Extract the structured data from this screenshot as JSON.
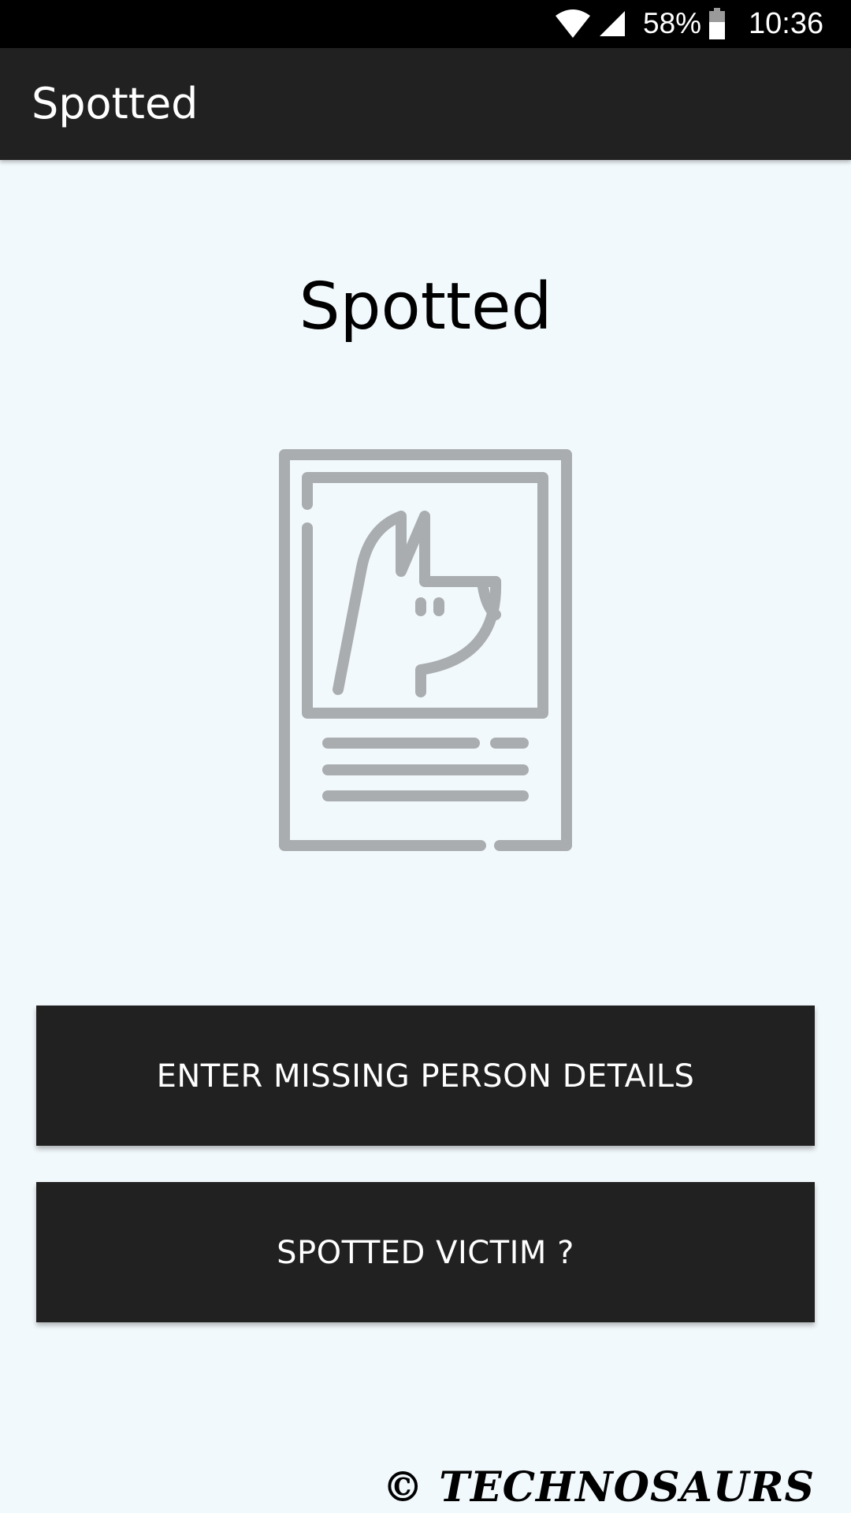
{
  "status_bar": {
    "battery_percent": "58%",
    "time": "10:36",
    "icons": [
      "wifi-icon",
      "cell-signal-icon",
      "battery-icon"
    ]
  },
  "app_bar": {
    "title": "Spotted"
  },
  "main": {
    "headline": "Spotted",
    "illustration": "missing-pet-poster-icon",
    "buttons": {
      "missing_person": "ENTER MISSING PERSON DETAILS",
      "spotted_victim": "SPOTTED VICTIM ?"
    }
  },
  "footer": {
    "copyright": "© TECHNOSAURS"
  },
  "colors": {
    "status_bar": "#000000",
    "app_bar": "#212121",
    "background": "#f2f9fc",
    "button": "#212121",
    "icon_gray": "#a9adaf"
  }
}
